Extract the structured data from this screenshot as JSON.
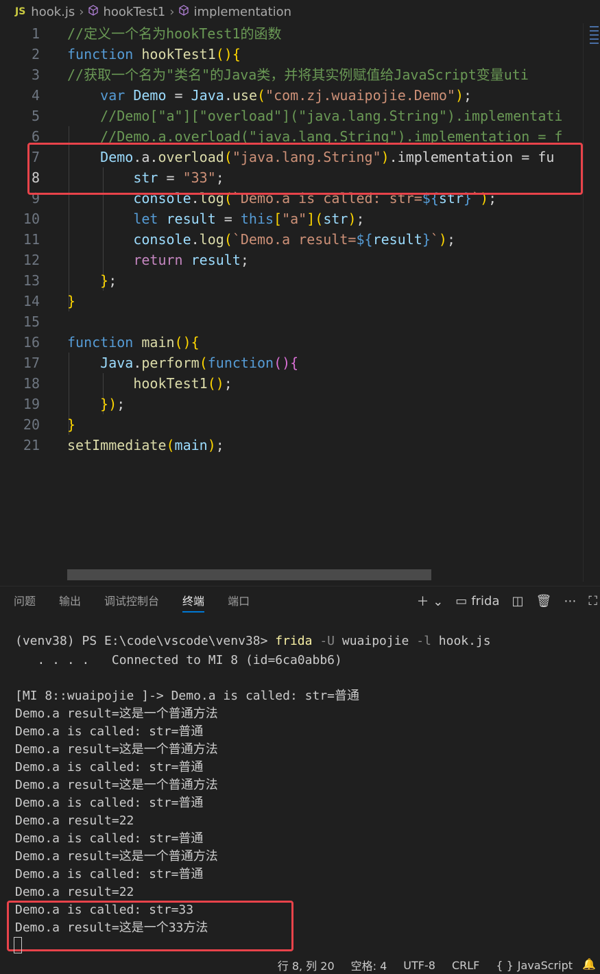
{
  "breadcrumb": {
    "file_badge": "JS",
    "file": "hook.js",
    "item1": "hookTest1",
    "item2": "implementation"
  },
  "editor": {
    "active_line": 8,
    "lines": [
      "//定义一个名为hookTest1的函数",
      "function hookTest1(){",
      "//获取一个名为\"类名\"的Java类，并将其实例赋值给JavaScript变量uti",
      "    var Demo = Java.use(\"com.zj.wuaipojie.Demo\");",
      "    //Demo[\"a\"][\"overload\"](\"java.lang.String\").implementati",
      "    //Demo.a.overload(\"java.lang.String\").implementation = f",
      "    Demo.a.overload(\"java.lang.String\").implementation = fu",
      "        str = \"33\";",
      "        console.log(`Demo.a is called: str=${str}`);",
      "        let result = this[\"a\"](str);",
      "        console.log(`Demo.a result=${result}`);",
      "        return result;",
      "    };",
      "}",
      "",
      "function main(){",
      "    Java.perform(function(){",
      "        hookTest1();",
      "    });",
      "}",
      "setImmediate(main);"
    ]
  },
  "panel": {
    "tabs": [
      "问题",
      "输出",
      "调试控制台",
      "终端",
      "端口"
    ],
    "active_tab": "终端",
    "terminal_name": "frida"
  },
  "terminal": {
    "prompt": "(venv38) PS E:\\code\\vscode\\venv38> ",
    "command": "frida",
    "flag_u": "-U",
    "arg_app": "wuaipojie",
    "flag_l": "-l",
    "arg_file": "hook.js",
    "output": [
      "   . . . .   Connected to MI 8 (id=6ca0abb6)",
      "",
      "[MI 8::wuaipojie ]-> Demo.a is called: str=普通",
      "Demo.a result=这是一个普通方法",
      "Demo.a is called: str=普通",
      "Demo.a result=这是一个普通方法",
      "Demo.a is called: str=普通",
      "Demo.a result=这是一个普通方法",
      "Demo.a is called: str=普通",
      "Demo.a result=22",
      "Demo.a is called: str=普通",
      "Demo.a result=这是一个普通方法",
      "Demo.a is called: str=普通",
      "Demo.a result=22",
      "Demo.a is called: str=33",
      "Demo.a result=这是一个33方法"
    ]
  },
  "statusbar": {
    "position": "行 8, 列 20",
    "spaces": "空格: 4",
    "encoding": "UTF-8",
    "eol": "CRLF",
    "language": "JavaScript"
  },
  "colors": {
    "background": "#1f1f1f",
    "highlight_box": "#e8434a",
    "active_tab_underline": "#0078d4"
  }
}
